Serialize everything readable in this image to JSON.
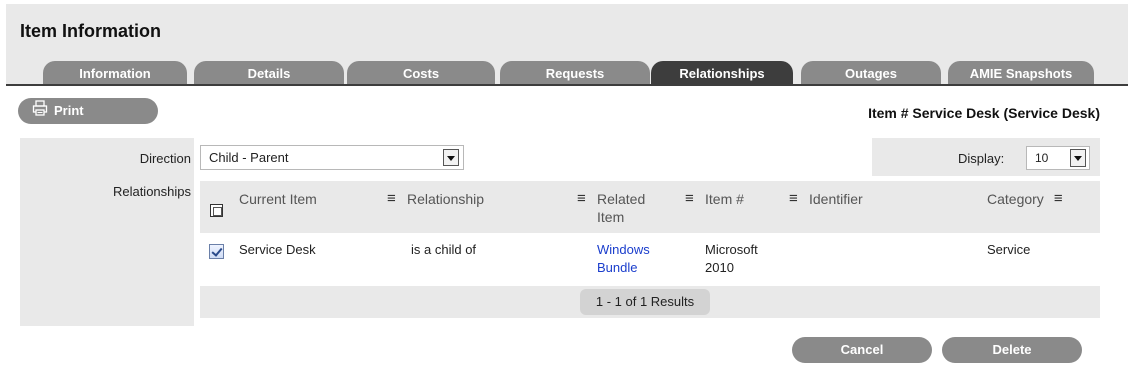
{
  "header": {
    "title": "Item Information"
  },
  "tabs": [
    {
      "label": "Information"
    },
    {
      "label": "Details"
    },
    {
      "label": "Costs"
    },
    {
      "label": "Requests"
    },
    {
      "label": "Relationships",
      "active": true
    },
    {
      "label": "Outages"
    },
    {
      "label": "AMIE Snapshots"
    }
  ],
  "toolbar": {
    "print_label": "Print",
    "item_heading": "Item # Service Desk (Service Desk)"
  },
  "form": {
    "direction_label": "Direction",
    "direction_value": "Child - Parent",
    "relationships_label": "Relationships",
    "display_label": "Display:",
    "display_value": "10"
  },
  "table": {
    "columns": [
      {
        "label": "Current Item"
      },
      {
        "label": "Relationship"
      },
      {
        "label": "Related Item"
      },
      {
        "label": "Item #"
      },
      {
        "label": "Identifier"
      },
      {
        "label": "Category"
      }
    ],
    "rows": [
      {
        "checked": true,
        "current_item": "Service Desk",
        "relationship": "is a child of",
        "related_item": "Windows Bundle",
        "item_number": "Microsoft 2010",
        "identifier": "",
        "category": "Service"
      }
    ],
    "results": "1 - 1 of 1 Results"
  },
  "actions": {
    "cancel_label": "Cancel",
    "delete_label": "Delete"
  },
  "colors": {
    "tab_active": "#3d3d3d",
    "tab_inactive": "#8a8a8a",
    "link": "#1a3dcc",
    "panel": "#e9e9e9"
  }
}
